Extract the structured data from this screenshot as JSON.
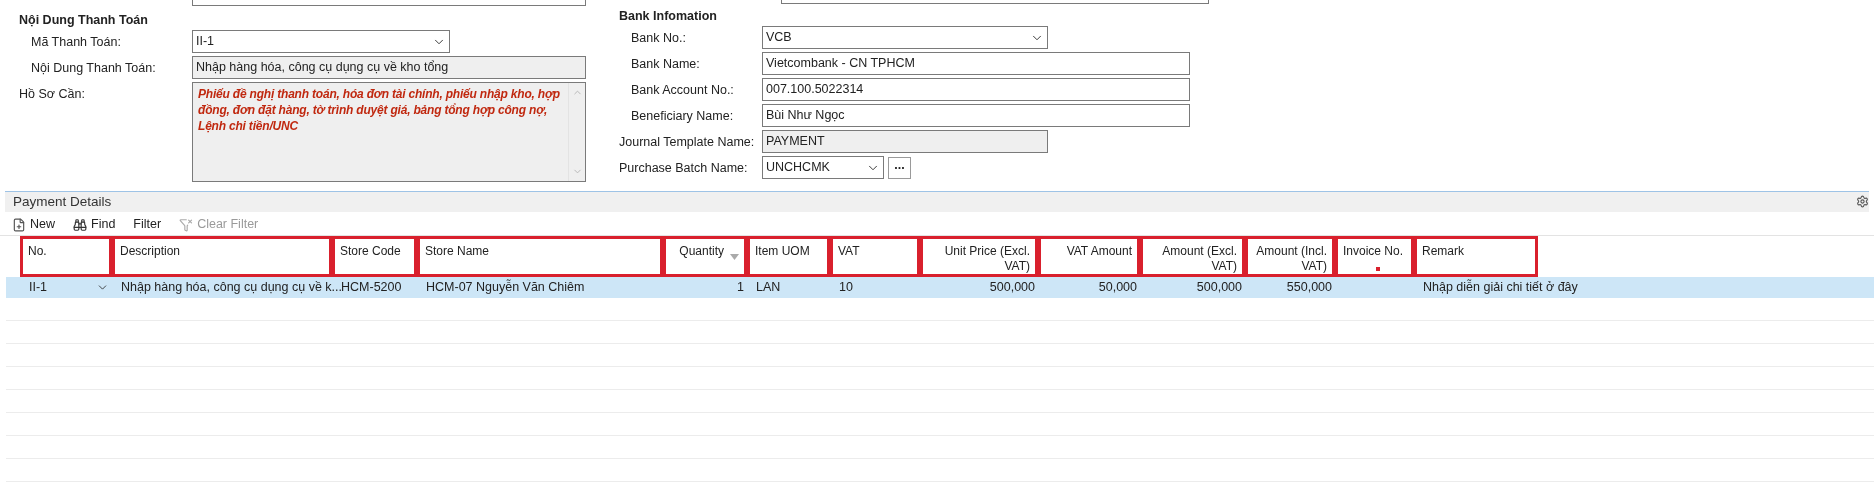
{
  "payment_section": {
    "title": "Nội Dung Thanh Toán",
    "fields": [
      {
        "kind": "dropdown",
        "label": "Mã Thanh Toán:",
        "value": "II-1"
      },
      {
        "kind": "readonly",
        "label": "Nội Dung Thanh Toán:",
        "value": "Nhập hàng hóa, công cụ dụng cụ về kho tổng"
      },
      {
        "kind": "memo",
        "label": "Hồ Sơ Cần:",
        "value": "Phiếu đề nghị thanh toán, hóa đơn tài chính, phiếu nhập kho, hợp đồng, đơn đặt hàng, tờ trình duyệt giá, bảng tổng hợp công nợ, Lệnh chi tiền/UNC"
      }
    ]
  },
  "bank_section": {
    "title": "Bank Infomation",
    "fields": [
      {
        "kind": "dropdown",
        "label": "Bank No.:",
        "value": "VCB"
      },
      {
        "kind": "text",
        "label": "Bank Name:",
        "value": "Vietcombank - CN TPHCM"
      },
      {
        "kind": "text",
        "label": "Bank Account No.:",
        "value": "007.100.5022314"
      },
      {
        "kind": "text",
        "label": "Beneficiary Name:",
        "value": "Bùi Như Ngọc"
      },
      {
        "kind": "readonly",
        "label": "Journal Template Name:",
        "value": "PAYMENT"
      },
      {
        "kind": "lookup",
        "label": "Purchase Batch Name:",
        "value": "UNCHCMK",
        "button": "..."
      }
    ]
  },
  "details": {
    "title": "Payment Details",
    "toolbar": [
      {
        "kind": "new",
        "label": "New",
        "disabled": false
      },
      {
        "kind": "find",
        "label": "Find",
        "disabled": false
      },
      {
        "kind": "filter",
        "label": "Filter",
        "disabled": false
      },
      {
        "kind": "clear",
        "label": "Clear Filter",
        "disabled": true
      }
    ],
    "columns": [
      {
        "label": "No.",
        "kind": "text",
        "highlighted": true
      },
      {
        "label": "Description",
        "kind": "text",
        "highlighted": true
      },
      {
        "label": "Store Code",
        "kind": "text",
        "highlighted": true
      },
      {
        "label": "Store Name",
        "kind": "text",
        "highlighted": true
      },
      {
        "label": "Quantity",
        "kind": "number",
        "highlighted": true,
        "sorted": true
      },
      {
        "label": "Item UOM",
        "kind": "text",
        "highlighted": true
      },
      {
        "label": "VAT",
        "kind": "text",
        "highlighted": true
      },
      {
        "label": "Unit Price (Excl. VAT)",
        "kind": "number",
        "highlighted": true
      },
      {
        "label": "VAT Amount",
        "kind": "number",
        "highlighted": true
      },
      {
        "label": "Amount (Excl. VAT)",
        "kind": "number",
        "highlighted": true
      },
      {
        "label": "Amount (Incl. VAT)",
        "kind": "number",
        "highlighted": true
      },
      {
        "label": "Invoice No.",
        "kind": "text",
        "highlighted": true,
        "marked": true
      },
      {
        "label": "Remark",
        "kind": "text",
        "highlighted": true
      }
    ],
    "rows": [
      {
        "selected": true,
        "cells": [
          "II-1",
          "Nhập hàng hóa, công cụ dụng cụ về k...",
          "HCM-5200",
          "HCM-07 Nguyễn Văn Chiêm",
          "1",
          "LAN",
          "10",
          "500,000",
          "50,000",
          "500,000",
          "550,000",
          "",
          "Nhập diễn giải chi tiết ở đây"
        ]
      }
    ]
  }
}
